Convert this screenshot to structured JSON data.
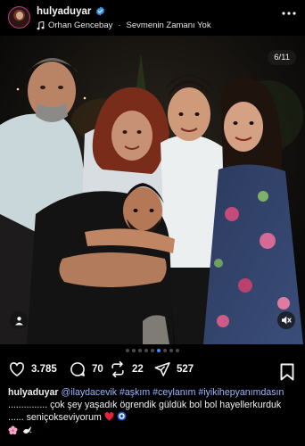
{
  "header": {
    "username": "hulyaduyar",
    "music_artist": "Orhan Gencebay",
    "music_separator": "·",
    "music_title": "Sevmenin Zamanı Yok"
  },
  "photo": {
    "counter": "6/11"
  },
  "carousel": {
    "total_dots": 9,
    "active_index": 5
  },
  "actions": {
    "likes": "3.785",
    "comments": "70",
    "reposts": "22",
    "shares": "527"
  },
  "caption": {
    "username": "hulyaduyar",
    "mention": "@ilaydacevik",
    "hashtags": [
      "#aşkım",
      "#ceylanım",
      "#iyikihepyanımdasın"
    ],
    "text": "............... çok şey yaşadık ögrendik güldük bol bol hayellerkurduk ...... seniçokseviyorum"
  },
  "colors": {
    "background": "#000000",
    "text": "#f5f5f5",
    "link": "#9db6ff",
    "active_dot": "#3b8ef5",
    "verified": "#3897f0"
  }
}
